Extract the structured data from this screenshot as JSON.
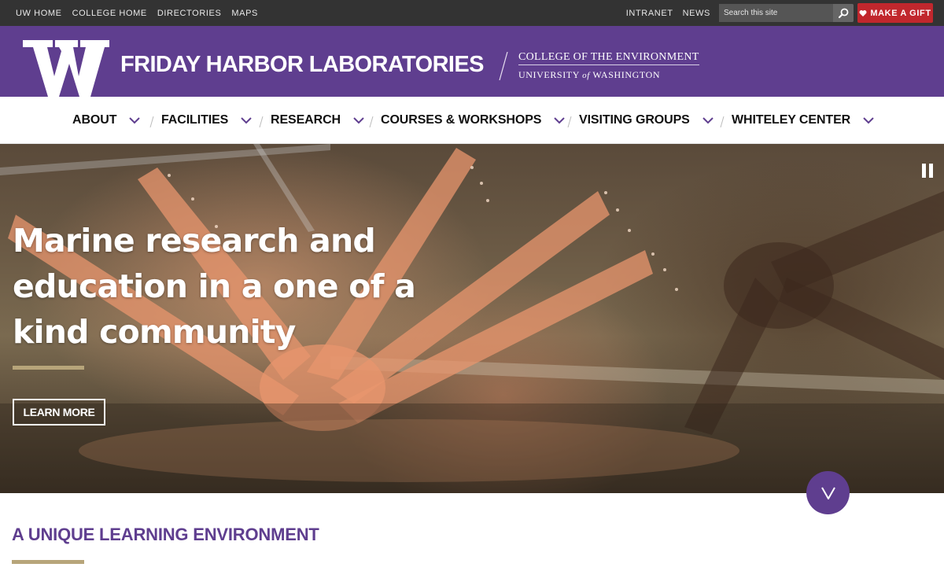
{
  "topbar": {
    "links": [
      "UW HOME",
      "COLLEGE HOME",
      "DIRECTORIES",
      "MAPS"
    ],
    "right_links": [
      "INTRANET",
      "NEWS"
    ],
    "search_placeholder": "Search this site",
    "gift_label": "MAKE A GIFT",
    "gift_color": "#c1272d"
  },
  "header": {
    "site_title": "FRIDAY HARBOR LABORATORIES",
    "college": "COLLEGE OF THE ENVIRONMENT",
    "university_pre": "UNIVERSITY",
    "university_of": "of",
    "university_post": "WASHINGTON",
    "brand_color": "#5f3e8f"
  },
  "nav": {
    "items": [
      "ABOUT",
      "FACILITIES",
      "RESEARCH",
      "COURSES & WORKSHOPS",
      "VISITING GROUPS",
      "WHITELEY CENTER"
    ]
  },
  "hero": {
    "title": "Marine research and education in a one of a kind community",
    "cta_label": "LEARN MORE",
    "accent_color": "#b7a57a"
  },
  "section": {
    "title": "A UNIQUE LEARNING ENVIRONMENT"
  },
  "icons": [
    "search-icon",
    "heart-icon",
    "chevron-down-icon",
    "pause-icon",
    "uw-w-logo"
  ]
}
